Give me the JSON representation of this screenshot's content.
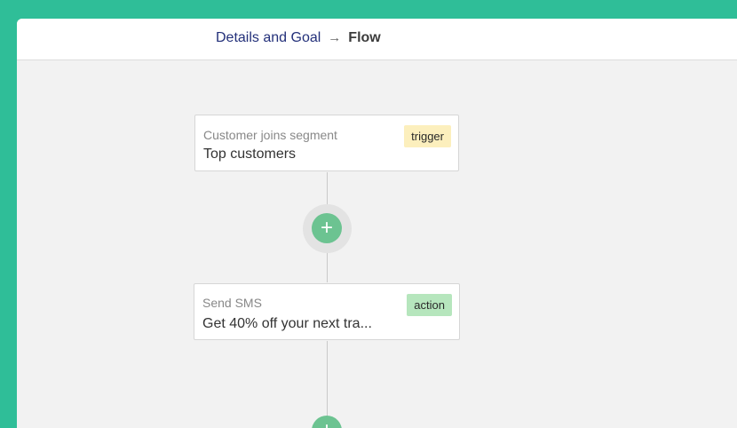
{
  "breadcrumb": {
    "step1": "Details and Goal",
    "separator": "→",
    "current": "Flow"
  },
  "flow": {
    "nodes": [
      {
        "subtitle": "Customer joins segment",
        "title": "Top customers",
        "badge": "trigger",
        "badge_color": "#fcefbd"
      },
      {
        "subtitle": "Send SMS",
        "title": "Get 40% off your next tra...",
        "badge": "action",
        "badge_color": "#b6e6bd"
      }
    ],
    "add_step_symbol": "+"
  },
  "colors": {
    "frame_accent": "#2fbe98",
    "add_button": "#6cc391",
    "breadcrumb_link": "#23307a"
  }
}
